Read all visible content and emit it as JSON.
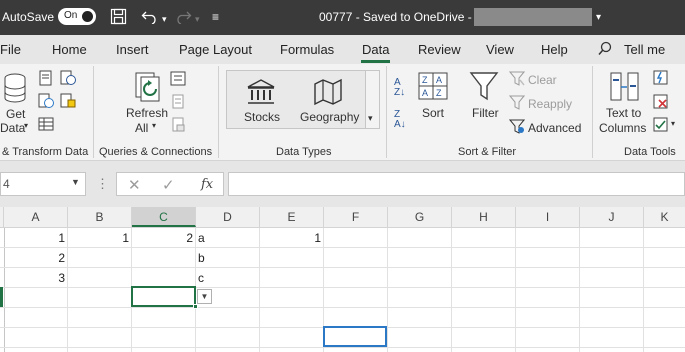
{
  "titlebar": {
    "autosave_label": "AutoSave",
    "toggle_label": "On",
    "doc_title": "00777  -  Saved to OneDrive -",
    "icons": [
      "save-icon",
      "undo-icon",
      "redo-icon",
      "customize-icon"
    ]
  },
  "menu": {
    "items": [
      "File",
      "Home",
      "Insert",
      "Page Layout",
      "Formulas",
      "Data",
      "Review",
      "View",
      "Help"
    ],
    "active": "Data",
    "tell_me": "Tell me"
  },
  "ribbon": {
    "get_data": {
      "line1": "Get",
      "line2": "Data"
    },
    "refresh": {
      "line1": "Refresh",
      "line2": "All"
    },
    "stocks": "Stocks",
    "geography": "Geography",
    "sort": "Sort",
    "filter": "Filter",
    "clear": "Clear",
    "reapply": "Reapply",
    "advanced": "Advanced",
    "text_to_columns": {
      "line1": "Text to",
      "line2": "Columns"
    },
    "groups": {
      "get_transform": "& Transform Data",
      "queries": "Queries & Connections",
      "data_types": "Data Types",
      "sort_filter": "Sort & Filter",
      "data_tools": "Data Tools"
    }
  },
  "formula_bar": {
    "name_box": "4",
    "fx": "fx",
    "formula": ""
  },
  "sheet": {
    "columns": [
      "A",
      "B",
      "C",
      "D",
      "E",
      "F",
      "G",
      "H",
      "I",
      "J",
      "K"
    ],
    "selected_column": "C",
    "cells": {
      "A1": "1",
      "B1": "1",
      "C1": "2",
      "D1": "a",
      "E1": "1",
      "A2": "2",
      "D2": "b",
      "A3": "3",
      "D3": "c"
    }
  },
  "colors": {
    "accent": "#217346",
    "titlebar": "#3a3a3a",
    "selection": "#2b78c6"
  }
}
